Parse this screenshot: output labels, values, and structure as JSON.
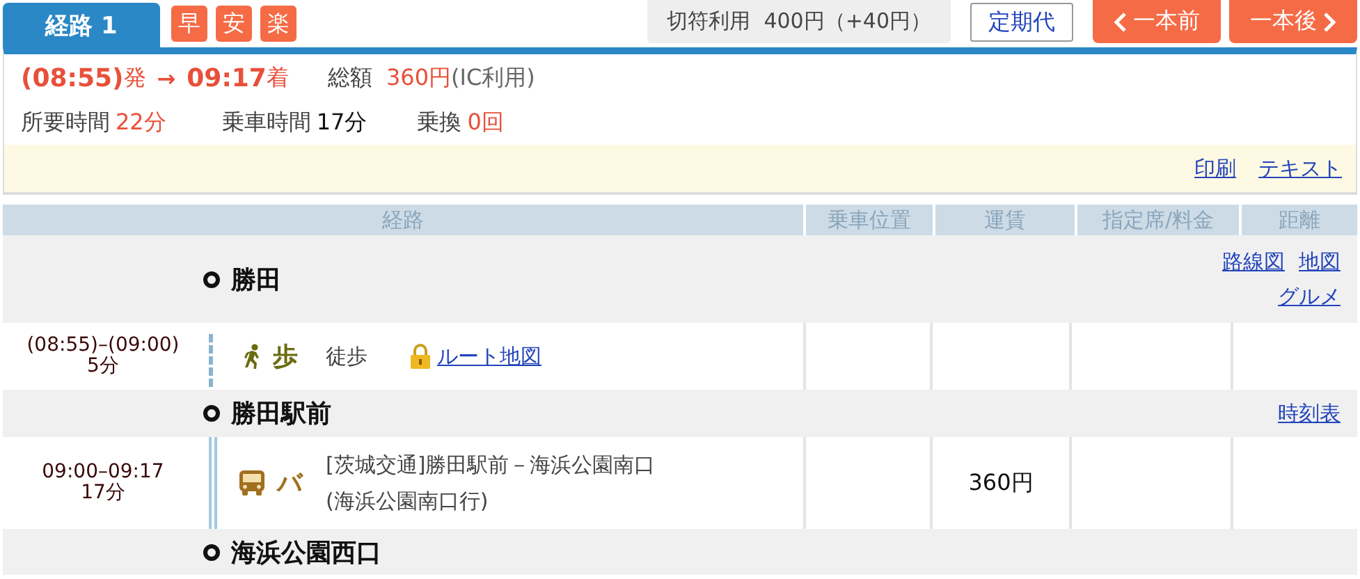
{
  "tabs": [
    {
      "label": "経路 1",
      "selected": true
    }
  ],
  "badges": [
    "早",
    "安",
    "楽"
  ],
  "ticket_fare": "切符利用  400円（+40円）",
  "commuter_button": "定期代",
  "prev_button": "一本前",
  "next_button": "一本後",
  "summary": {
    "depart_time": "(08:55)",
    "depart_suffix": "発",
    "arrow": "→",
    "arrive_time": "09:17",
    "arrive_suffix": "着",
    "total_label": "総額",
    "total": "360円",
    "total_note": "(IC利用)",
    "duration_label": "所要時間",
    "duration": "22分",
    "ride_label": "乗車時間",
    "ride": "17分",
    "transfer_label": "乗換",
    "transfer": "0回"
  },
  "links": [
    "印刷",
    "テキスト"
  ],
  "table": {
    "columns": [
      "経路",
      "乗車位置",
      "運賃",
      "指定席/料金",
      "距離"
    ],
    "rows": [
      {
        "kind": "station",
        "name": "勝田",
        "links": [
          "路線図",
          "地図",
          "グルメ"
        ]
      },
      {
        "kind": "walk",
        "time": "(08:55)–(09:00)",
        "duration": "5分",
        "mode_label": "歩",
        "description": "徒歩",
        "link": "ルート地図"
      },
      {
        "kind": "station",
        "name": "勝田駅前",
        "links": [
          "時刻表"
        ]
      },
      {
        "kind": "bus",
        "time": "09:00–09:17",
        "duration": "17分",
        "mode_label": "バ",
        "description": "[茨城交通]勝田駅前－海浜公園南口(海浜公園南口行)",
        "fare": "360円"
      },
      {
        "kind": "station",
        "name": "海浜公園西口"
      }
    ]
  }
}
